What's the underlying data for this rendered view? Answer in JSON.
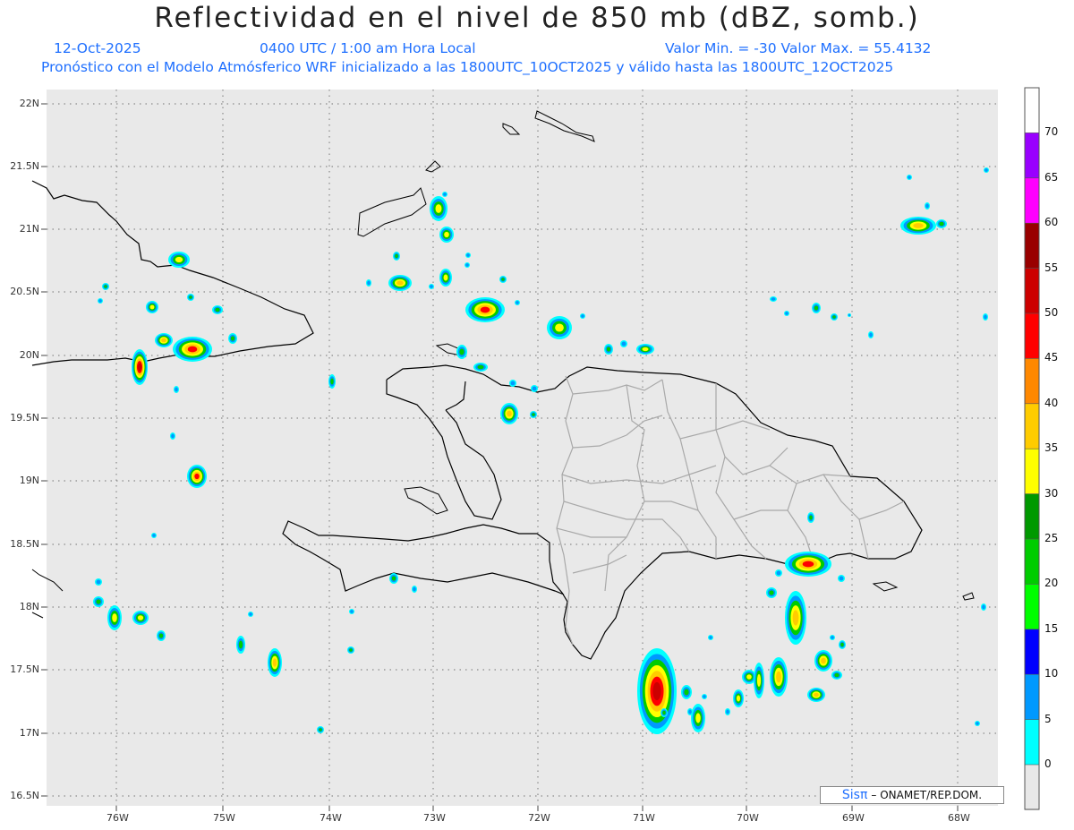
{
  "title": "Reflectividad en el nivel de 850 mb (dBZ, somb.)",
  "date": "12-Oct-2025",
  "time": "0400 UTC / 1:00 am Hora Local",
  "minmax": "Valor Min. = -30  Valor Max. = 55.4132",
  "forecast": "Pronóstico con el Modelo Atmósferico WRF inicializado a las 1800UTC_10OCT2025 y válido hasta las  1800UTC_12OCT2025",
  "credit": {
    "brand": "Sisπ",
    "text": "– ONAMET/REP.DOM."
  },
  "lat_labels": [
    "22N",
    "21.5N",
    "21N",
    "20.5N",
    "20N",
    "19.5N",
    "19N",
    "18.5N",
    "18N",
    "17.5N",
    "17N",
    "16.5N"
  ],
  "lon_labels": [
    "76W",
    "75W",
    "74W",
    "73W",
    "72W",
    "71W",
    "70W",
    "69W",
    "68W"
  ],
  "colorbar": {
    "ticks": [
      "70",
      "65",
      "60",
      "55",
      "50",
      "45",
      "40",
      "35",
      "30",
      "25",
      "20",
      "15",
      "10",
      "5",
      "0"
    ],
    "colors": [
      "#ffffff",
      "#9900ff",
      "#ff00ff",
      "#990000",
      "#cc0000",
      "#ff0000",
      "#ff8800",
      "#ffcc00",
      "#ffff00",
      "#009900",
      "#00cc00",
      "#00ff00",
      "#0000ff",
      "#0099ff",
      "#00ffff",
      "#e8e8e8"
    ]
  }
}
